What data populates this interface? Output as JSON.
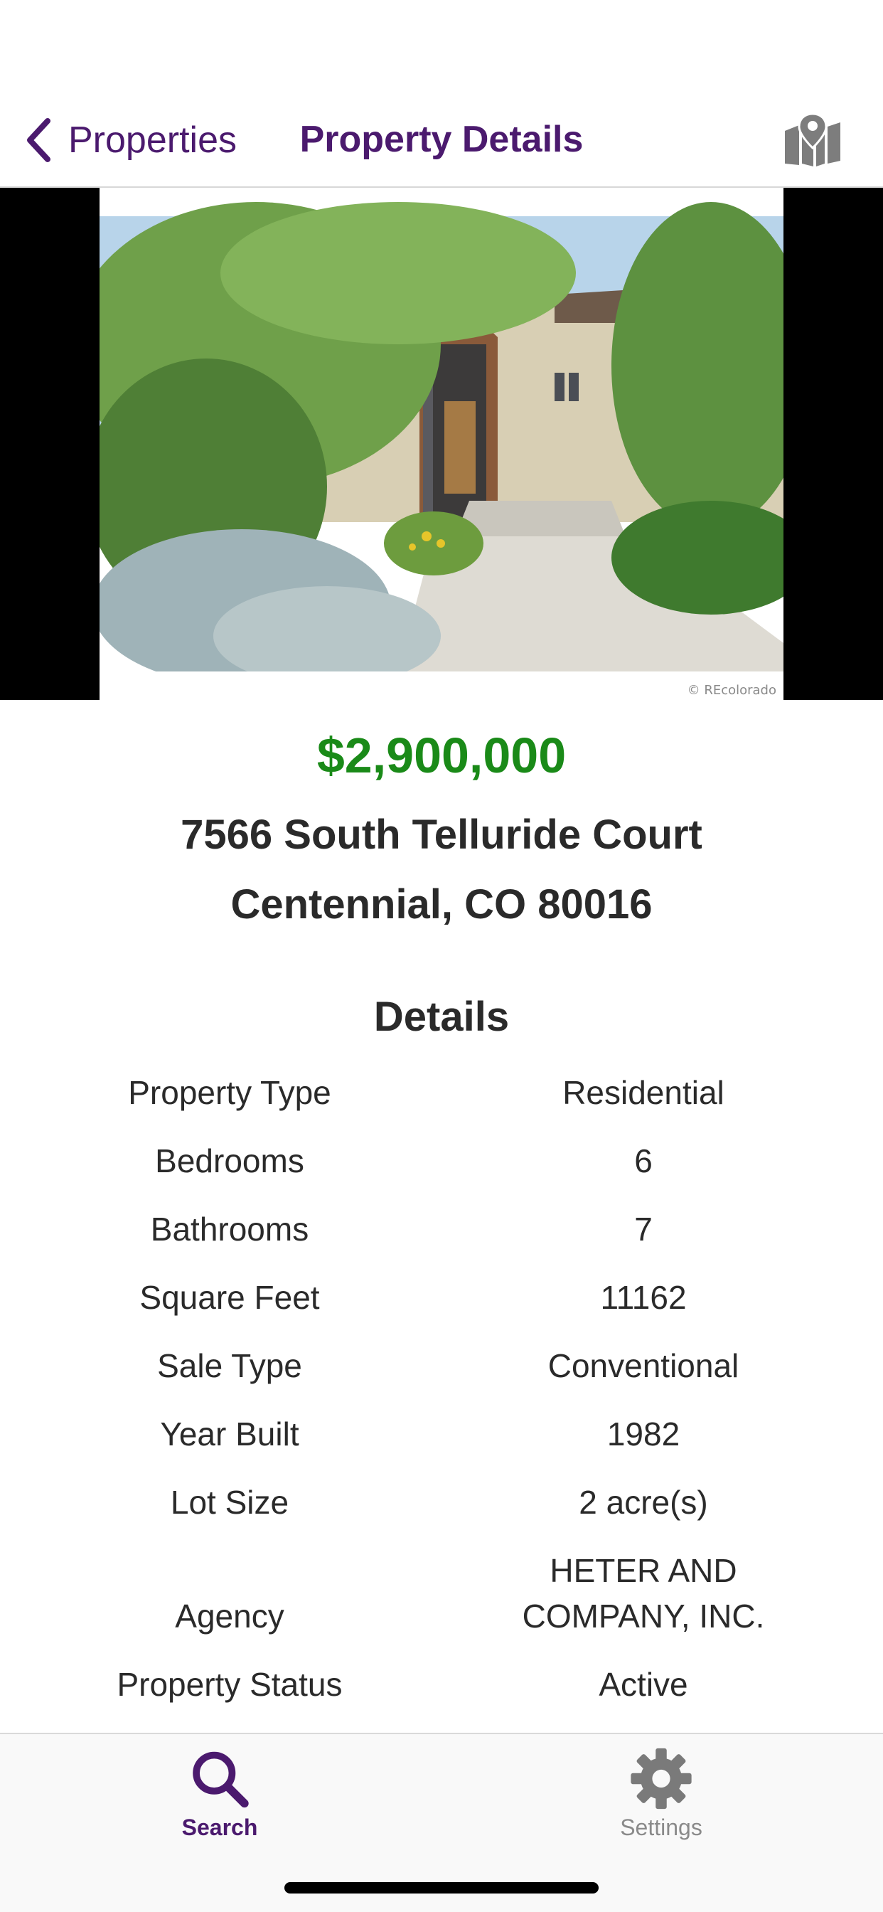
{
  "nav": {
    "back_label": "Properties",
    "title": "Property Details",
    "map_icon": "map-icon"
  },
  "listing": {
    "photo_watermark": "© REcolorado",
    "price": "$2,900,000",
    "address_line1": "7566 South Telluride Court",
    "address_line2": "Centennial, CO 80016"
  },
  "details": {
    "heading": "Details",
    "rows": [
      {
        "label": "Property Type",
        "value": "Residential"
      },
      {
        "label": "Bedrooms",
        "value": "6"
      },
      {
        "label": "Bathrooms",
        "value": "7"
      },
      {
        "label": "Square Feet",
        "value": "11162"
      },
      {
        "label": "Sale Type",
        "value": "Conventional"
      },
      {
        "label": "Year Built",
        "value": "1982"
      },
      {
        "label": "Lot Size",
        "value": "2 acre(s)"
      },
      {
        "label": "Agency",
        "value": "HETER AND",
        "value_line2": "COMPANY, INC."
      },
      {
        "label": "Property Status",
        "value": "Active"
      }
    ]
  },
  "tabbar": {
    "search_label": "Search",
    "settings_label": "Settings"
  },
  "colors": {
    "accent": "#4b1a6e",
    "price": "#1a8a18",
    "text": "#2a2a2a",
    "inactive_tab": "#8a8a8a"
  }
}
